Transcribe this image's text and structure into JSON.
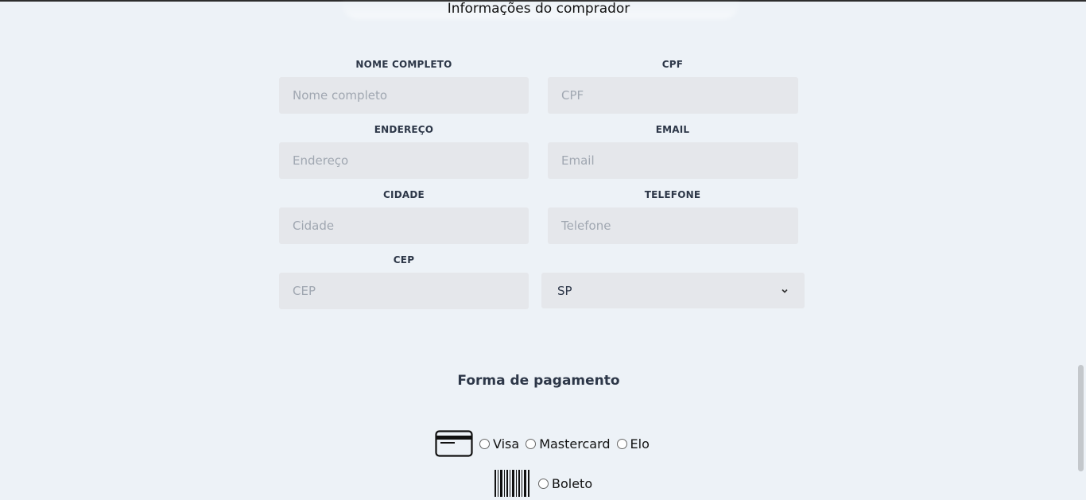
{
  "buyer_section": {
    "title": "Informações do comprador",
    "fields": {
      "nome": {
        "label": "NOME COMPLETO",
        "placeholder": "Nome completo"
      },
      "cpf": {
        "label": "CPF",
        "placeholder": "CPF"
      },
      "endereco": {
        "label": "ENDEREÇO",
        "placeholder": "Endereço"
      },
      "email": {
        "label": "EMAIL",
        "placeholder": "Email"
      },
      "cidade": {
        "label": "CIDADE",
        "placeholder": "Cidade"
      },
      "telefone": {
        "label": "TELEFONE",
        "placeholder": "Telefone"
      },
      "cep": {
        "label": "CEP",
        "placeholder": "CEP"
      }
    },
    "state_select": {
      "selected": "SP"
    }
  },
  "payment_section": {
    "title": "Forma de pagamento",
    "card_options": [
      "Visa",
      "Mastercard",
      "Elo"
    ],
    "boleto_option": "Boleto",
    "icons": {
      "card": "credit-card-icon",
      "boleto": "barcode-icon"
    }
  }
}
